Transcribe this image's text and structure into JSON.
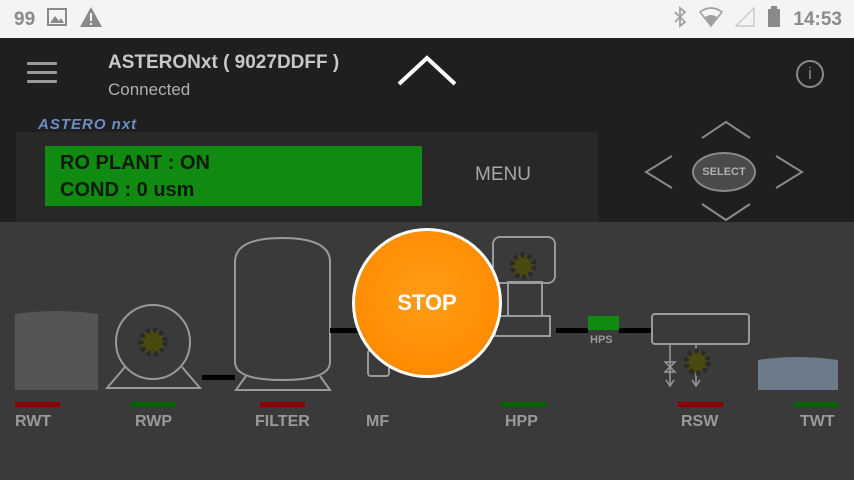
{
  "status_bar": {
    "notification_count": "99",
    "time": "14:53",
    "icons": [
      "image-icon",
      "warning-icon",
      "bluetooth-icon",
      "wifi-icon",
      "signal-icon",
      "battery-icon"
    ]
  },
  "app_bar": {
    "device_title": "ASTERONxt ( 9027DDFF )",
    "connection_status": "Connected"
  },
  "panel": {
    "brand": "ASTERO nxt",
    "lcd_line1": "RO PLANT : ON",
    "lcd_line2": "COND :  0 usm",
    "menu_label": "MENU",
    "select_label": "SELECT"
  },
  "process": {
    "stop_label": "STOP",
    "hps_label": "HPS",
    "components": [
      {
        "label": "RWT",
        "status_color": "#8b0000"
      },
      {
        "label": "RWP",
        "status_color": "#006400"
      },
      {
        "label": "FILTER",
        "status_color": "#8b0000"
      },
      {
        "label": "MF",
        "status_color": ""
      },
      {
        "label": "HPP",
        "status_color": "#006400"
      },
      {
        "label": "RSW",
        "status_color": "#8b0000"
      },
      {
        "label": "TWT",
        "status_color": "#006400"
      }
    ]
  },
  "colors": {
    "lcd_bg": "#108a10",
    "stop_button": "#ff8c00",
    "status_red": "#8b0000",
    "status_green": "#006400",
    "tank_water": "#6c7a8a"
  }
}
